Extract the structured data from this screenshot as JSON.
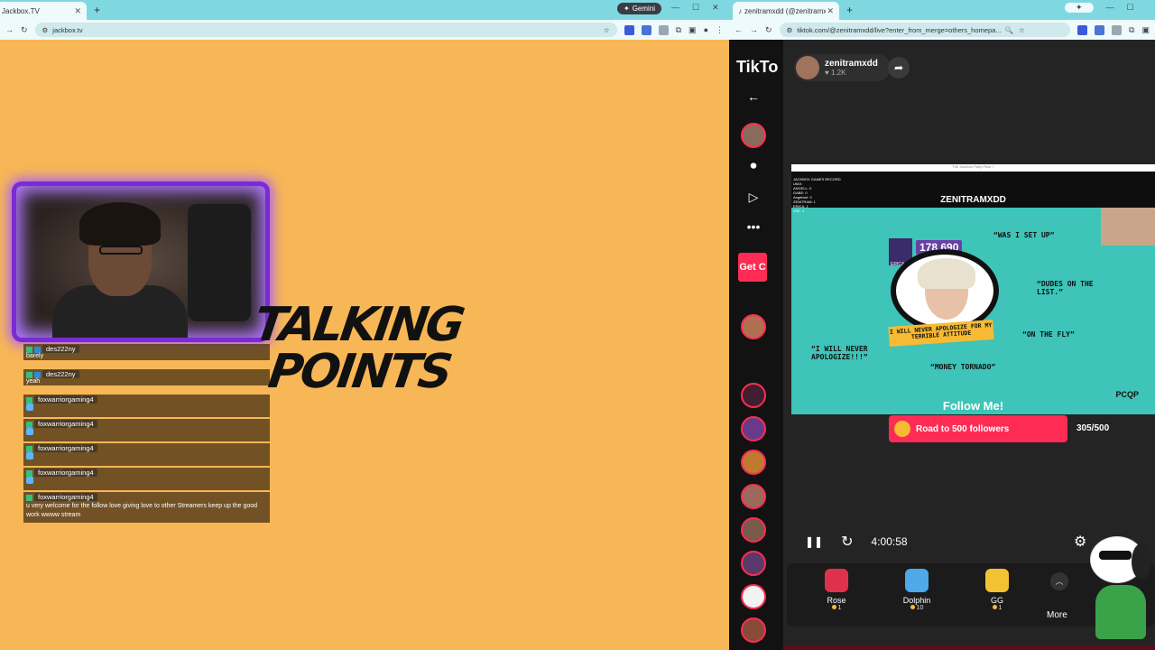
{
  "left_window": {
    "tab_title": "Jackbox.TV",
    "url": "jackbox.tv",
    "gemini_label": "Gemini",
    "chat": [
      {
        "user": "des222ny",
        "msg": "barely"
      },
      {
        "user": "des222ny",
        "msg": "yeah"
      },
      {
        "user": "foxwarriorgaming4",
        "msg": ""
      },
      {
        "user": "foxwarriorgaming4",
        "msg": ""
      },
      {
        "user": "foxwarriorgaming4",
        "msg": ""
      },
      {
        "user": "foxwarriorgaming4",
        "msg": ""
      },
      {
        "user": "foxwarriorgaming4",
        "msg": "u very welcome for the follow love giving love to other Streamers keep up the good work wwww stream"
      }
    ],
    "logo": {
      "line1": "TALKING",
      "line2": "POINTS"
    }
  },
  "right_window": {
    "tab_title": "zenitramxdd (@zenitramxdd) is ...",
    "url": "tiktok.com/@zenitramxdd/live?enter_from_merge=others_homepa...",
    "tiktok_logo": "TikTo",
    "get_coins": "Get C",
    "host": {
      "name": "zenitramxdd",
      "likes": "1.2K"
    },
    "video": {
      "top_caption": "The Jackbox Party Pack 7",
      "scoreboard": [
        "JACKBOX GAMES RECORD",
        "UMJI:",
        "ANGELL: 0",
        "GABE: 0",
        "Angelwel: 0",
        "ZENITRAM: 1",
        "ERICA: 1",
        "JOE: 1"
      ],
      "player_name": "ZENITRAMXDD",
      "score": "178,690",
      "score_label": "ERICA",
      "quotes": [
        "“WAS I SET UP”",
        "“DUDES ON THE LIST.”",
        "“ON THE FLY”",
        "“I WILL NEVER APOLOGIZE!!!”",
        "“MONEY TORNADO”"
      ],
      "banner": "I WILL NEVER APOLOGIZE FOR MY TERRIBLE ATTITUDE",
      "follow_text": "Follow Me!",
      "pcqp": "PCQP"
    },
    "goal": {
      "label": "Road to 500 followers",
      "count": "305/500"
    },
    "timer": "4:00:58",
    "gifts": [
      {
        "name": "Rose",
        "price": "1",
        "color": "#e0314b"
      },
      {
        "name": "Dolphin",
        "price": "10",
        "color": "#4fa8e8"
      },
      {
        "name": "GG",
        "price": "1",
        "color": "#f2c233"
      }
    ],
    "more_label": "More"
  }
}
